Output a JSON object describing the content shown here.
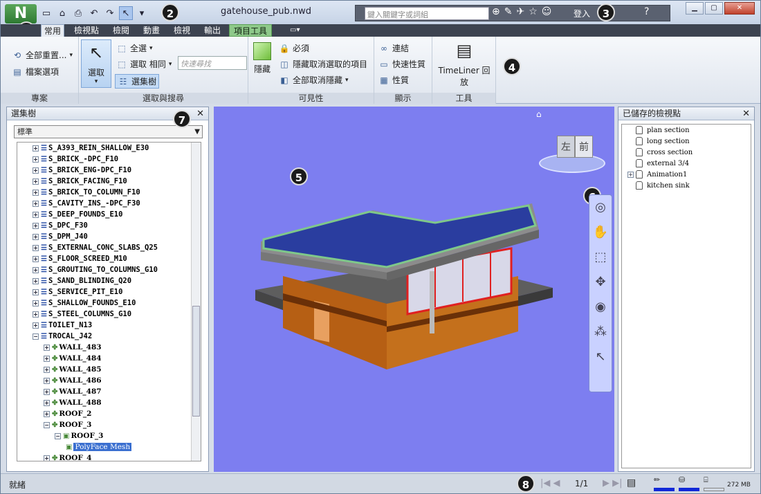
{
  "app": {
    "logo": "N",
    "document_title": "gatehouse_pub.nwd"
  },
  "qat": {
    "icons": [
      "new-icon",
      "open-icon",
      "print-icon",
      "undo-icon",
      "redo-icon",
      "select-icon"
    ]
  },
  "search": {
    "placeholder": "鍵入關鍵字或詞組",
    "login": "登入"
  },
  "tabs": [
    {
      "label": "常用"
    },
    {
      "label": "檢視點"
    },
    {
      "label": "檢閱"
    },
    {
      "label": "動畫"
    },
    {
      "label": "檢視"
    },
    {
      "label": "輸出"
    },
    {
      "label": "項目工具"
    }
  ],
  "ribbon": {
    "project": {
      "title": "專案",
      "reset": "全部重置...",
      "file_options": "檔案選項"
    },
    "select": {
      "title": "選取與搜尋",
      "select_big": "選取",
      "select_all": "全選",
      "select_same": "選取 相同",
      "selection_tree": "選集樹",
      "quick_find": "快速尋找"
    },
    "visibility": {
      "title": "可見性",
      "hide": "隱藏",
      "require": "必須",
      "hide_unselected": "隱藏取消選取的項目",
      "unhide_all": "全部取消隱藏"
    },
    "display": {
      "title": "顯示",
      "links": "連結",
      "quick_props": "快速性質",
      "props": "性質"
    },
    "tools": {
      "title": "工具",
      "timeliner": "TimeLiner 回放"
    }
  },
  "left_panel": {
    "title": "選集樹",
    "combo": "標準",
    "rows": [
      {
        "label": "S_A393_REIN_SHALLOW_E30"
      },
      {
        "label": "S_BRICK_-DPC_F10"
      },
      {
        "label": "S_BRICK_ENG-DPC_F10"
      },
      {
        "label": "S_BRICK_FACING_F10"
      },
      {
        "label": "S_BRICK_TO_COLUMN_F10"
      },
      {
        "label": "S_CAVITY_INS_-DPC_F30"
      },
      {
        "label": "S_DEEP_FOUNDS_E10"
      },
      {
        "label": "S_DPC_F30"
      },
      {
        "label": "S_DPM_J40"
      },
      {
        "label": "S_EXTERNAL_CONC_SLABS_Q25"
      },
      {
        "label": "S_FLOOR_SCREED_M10"
      },
      {
        "label": "S_GROUTING_TO_COLUMNS_G10"
      },
      {
        "label": "S_SAND_BLINDING_Q20"
      },
      {
        "label": "S_SERVICE_PIT_E10"
      },
      {
        "label": "S_SHALLOW_FOUNDS_E10"
      },
      {
        "label": "S_STEEL_COLUMNS_G10"
      },
      {
        "label": "TOILET_N13"
      },
      {
        "label": "TROCAL_J42"
      },
      {
        "label": "WALL_483"
      },
      {
        "label": "WALL_484"
      },
      {
        "label": "WALL_485"
      },
      {
        "label": "WALL_486"
      },
      {
        "label": "WALL_487"
      },
      {
        "label": "WALL_488"
      },
      {
        "label": "ROOF_2"
      },
      {
        "label": "ROOF_3"
      },
      {
        "label": "ROOF_3"
      },
      {
        "label": "PolyFace Mesh"
      },
      {
        "label": "ROOF_4"
      }
    ]
  },
  "right_panel": {
    "title": "已儲存的檢視點",
    "viewpoints": [
      {
        "label": "plan section"
      },
      {
        "label": "long section"
      },
      {
        "label": "cross section"
      },
      {
        "label": "external 3/4"
      },
      {
        "label": "Animation1"
      },
      {
        "label": "kitchen sink"
      }
    ]
  },
  "viewcube": {
    "left": "左",
    "front": "前"
  },
  "callouts": [
    "1",
    "2",
    "3",
    "4",
    "5",
    "6",
    "7",
    "8"
  ],
  "status": {
    "text": "就緒",
    "page": "1/1",
    "memory": "272 MB"
  }
}
